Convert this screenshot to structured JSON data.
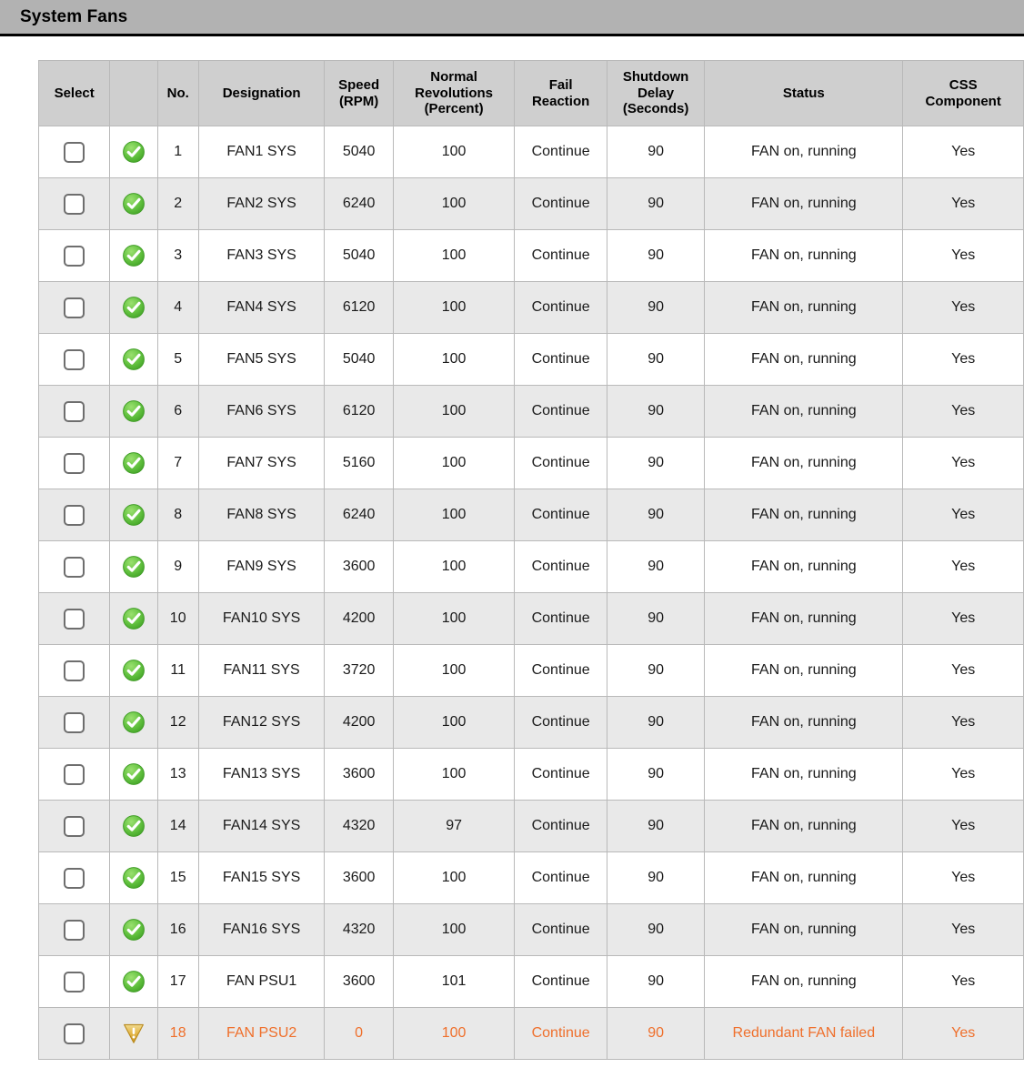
{
  "window": {
    "title": "System Fans"
  },
  "colors": {
    "titlebar_bg": "#b2b2b2",
    "header_bg": "#cfcfcf",
    "row_alt_bg": "#e9e9e9",
    "grid_line": "#b9b9b9",
    "warning_text": "#ef6f2b",
    "ok_icon_green": "#5bbd3a",
    "warn_icon_amber": "#e0ae3c"
  },
  "table": {
    "columns": [
      {
        "key": "select",
        "label": "Select"
      },
      {
        "key": "state",
        "label": ""
      },
      {
        "key": "no",
        "label": "No."
      },
      {
        "key": "desig",
        "label": "Designation"
      },
      {
        "key": "speed",
        "label": "Speed\n(RPM)"
      },
      {
        "key": "normrev",
        "label": "Normal\nRevolutions\n(Percent)"
      },
      {
        "key": "fail",
        "label": "Fail\nReaction"
      },
      {
        "key": "shutdown",
        "label": "Shutdown\nDelay\n(Seconds)"
      },
      {
        "key": "status",
        "label": "Status"
      },
      {
        "key": "css",
        "label": "CSS\nComponent"
      }
    ],
    "header_lines": {
      "select": [
        "Select"
      ],
      "state": [
        ""
      ],
      "no": [
        "No."
      ],
      "desig": [
        "Designation"
      ],
      "speed": [
        "Speed",
        "(RPM)"
      ],
      "normrev": [
        "Normal",
        "Revolutions",
        "(Percent)"
      ],
      "fail": [
        "Fail",
        "Reaction"
      ],
      "shutdown": [
        "Shutdown",
        "Delay",
        "(Seconds)"
      ],
      "status": [
        "Status"
      ],
      "css": [
        "CSS",
        "Component"
      ]
    },
    "rows": [
      {
        "selected": false,
        "state": "ok",
        "no": "1",
        "desig": "FAN1 SYS",
        "speed": "5040",
        "normrev": "100",
        "fail": "Continue",
        "shutdown": "90",
        "status": "FAN on, running",
        "css": "Yes"
      },
      {
        "selected": false,
        "state": "ok",
        "no": "2",
        "desig": "FAN2 SYS",
        "speed": "6240",
        "normrev": "100",
        "fail": "Continue",
        "shutdown": "90",
        "status": "FAN on, running",
        "css": "Yes"
      },
      {
        "selected": false,
        "state": "ok",
        "no": "3",
        "desig": "FAN3 SYS",
        "speed": "5040",
        "normrev": "100",
        "fail": "Continue",
        "shutdown": "90",
        "status": "FAN on, running",
        "css": "Yes"
      },
      {
        "selected": false,
        "state": "ok",
        "no": "4",
        "desig": "FAN4 SYS",
        "speed": "6120",
        "normrev": "100",
        "fail": "Continue",
        "shutdown": "90",
        "status": "FAN on, running",
        "css": "Yes"
      },
      {
        "selected": false,
        "state": "ok",
        "no": "5",
        "desig": "FAN5 SYS",
        "speed": "5040",
        "normrev": "100",
        "fail": "Continue",
        "shutdown": "90",
        "status": "FAN on, running",
        "css": "Yes"
      },
      {
        "selected": false,
        "state": "ok",
        "no": "6",
        "desig": "FAN6 SYS",
        "speed": "6120",
        "normrev": "100",
        "fail": "Continue",
        "shutdown": "90",
        "status": "FAN on, running",
        "css": "Yes"
      },
      {
        "selected": false,
        "state": "ok",
        "no": "7",
        "desig": "FAN7 SYS",
        "speed": "5160",
        "normrev": "100",
        "fail": "Continue",
        "shutdown": "90",
        "status": "FAN on, running",
        "css": "Yes"
      },
      {
        "selected": false,
        "state": "ok",
        "no": "8",
        "desig": "FAN8 SYS",
        "speed": "6240",
        "normrev": "100",
        "fail": "Continue",
        "shutdown": "90",
        "status": "FAN on, running",
        "css": "Yes"
      },
      {
        "selected": false,
        "state": "ok",
        "no": "9",
        "desig": "FAN9 SYS",
        "speed": "3600",
        "normrev": "100",
        "fail": "Continue",
        "shutdown": "90",
        "status": "FAN on, running",
        "css": "Yes"
      },
      {
        "selected": false,
        "state": "ok",
        "no": "10",
        "desig": "FAN10 SYS",
        "speed": "4200",
        "normrev": "100",
        "fail": "Continue",
        "shutdown": "90",
        "status": "FAN on, running",
        "css": "Yes"
      },
      {
        "selected": false,
        "state": "ok",
        "no": "11",
        "desig": "FAN11 SYS",
        "speed": "3720",
        "normrev": "100",
        "fail": "Continue",
        "shutdown": "90",
        "status": "FAN on, running",
        "css": "Yes"
      },
      {
        "selected": false,
        "state": "ok",
        "no": "12",
        "desig": "FAN12 SYS",
        "speed": "4200",
        "normrev": "100",
        "fail": "Continue",
        "shutdown": "90",
        "status": "FAN on, running",
        "css": "Yes"
      },
      {
        "selected": false,
        "state": "ok",
        "no": "13",
        "desig": "FAN13 SYS",
        "speed": "3600",
        "normrev": "100",
        "fail": "Continue",
        "shutdown": "90",
        "status": "FAN on, running",
        "css": "Yes"
      },
      {
        "selected": false,
        "state": "ok",
        "no": "14",
        "desig": "FAN14 SYS",
        "speed": "4320",
        "normrev": "97",
        "fail": "Continue",
        "shutdown": "90",
        "status": "FAN on, running",
        "css": "Yes"
      },
      {
        "selected": false,
        "state": "ok",
        "no": "15",
        "desig": "FAN15 SYS",
        "speed": "3600",
        "normrev": "100",
        "fail": "Continue",
        "shutdown": "90",
        "status": "FAN on, running",
        "css": "Yes"
      },
      {
        "selected": false,
        "state": "ok",
        "no": "16",
        "desig": "FAN16 SYS",
        "speed": "4320",
        "normrev": "100",
        "fail": "Continue",
        "shutdown": "90",
        "status": "FAN on, running",
        "css": "Yes"
      },
      {
        "selected": false,
        "state": "ok",
        "no": "17",
        "desig": "FAN PSU1",
        "speed": "3600",
        "normrev": "101",
        "fail": "Continue",
        "shutdown": "90",
        "status": "FAN on, running",
        "css": "Yes"
      },
      {
        "selected": false,
        "state": "warning",
        "no": "18",
        "desig": "FAN PSU2",
        "speed": "0",
        "normrev": "100",
        "fail": "Continue",
        "shutdown": "90",
        "status": "Redundant FAN failed",
        "css": "Yes"
      }
    ]
  },
  "icons": {
    "ok": "status-ok-check-icon",
    "warning": "status-warning-triangle-icon",
    "checkbox": "row-select-checkbox"
  }
}
